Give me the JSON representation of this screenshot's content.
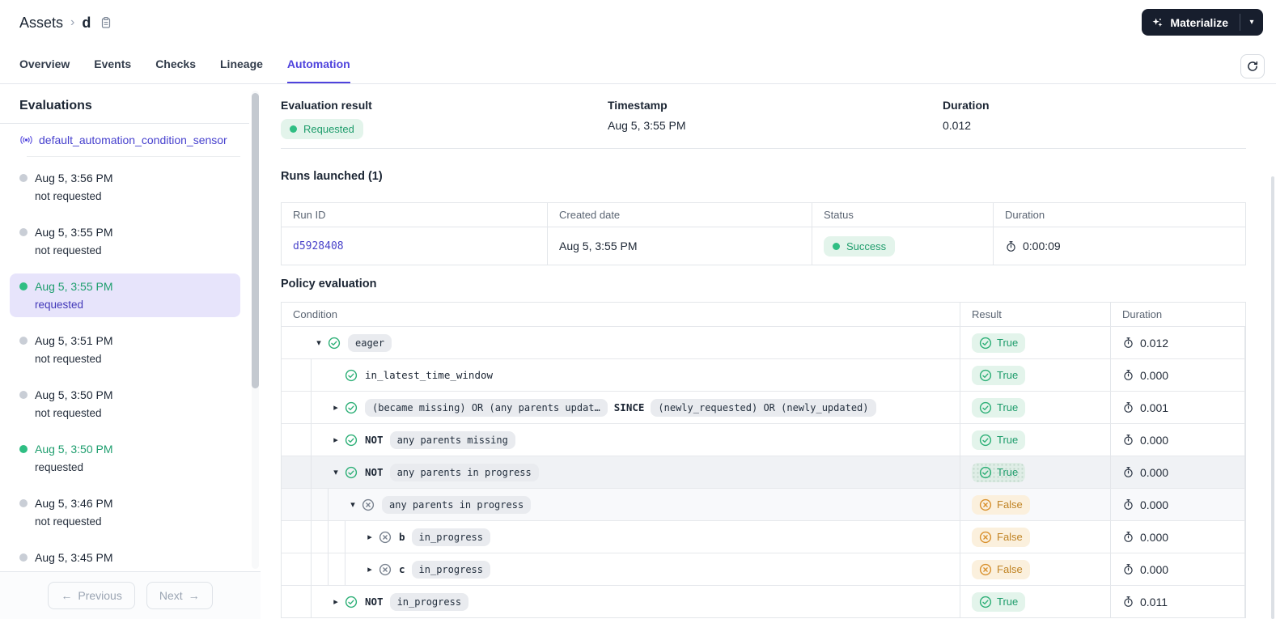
{
  "header": {
    "breadcrumb": {
      "root": "Assets",
      "separator": "›",
      "current": "d"
    },
    "materialize_button": {
      "label": "Materialize"
    }
  },
  "tabs": [
    {
      "label": "Overview",
      "active": false
    },
    {
      "label": "Events",
      "active": false
    },
    {
      "label": "Checks",
      "active": false
    },
    {
      "label": "Lineage",
      "active": false
    },
    {
      "label": "Automation",
      "active": true
    }
  ],
  "sidebar": {
    "title": "Evaluations",
    "sensor_link": "default_automation_condition_sensor",
    "evaluations": [
      {
        "timestamp": "Aug 5, 3:56 PM",
        "status": "not requested",
        "requested": false,
        "selected": false
      },
      {
        "timestamp": "Aug 5, 3:55 PM",
        "status": "not requested",
        "requested": false,
        "selected": false
      },
      {
        "timestamp": "Aug 5, 3:55 PM",
        "status": "requested",
        "requested": true,
        "selected": true
      },
      {
        "timestamp": "Aug 5, 3:51 PM",
        "status": "not requested",
        "requested": false,
        "selected": false
      },
      {
        "timestamp": "Aug 5, 3:50 PM",
        "status": "not requested",
        "requested": false,
        "selected": false
      },
      {
        "timestamp": "Aug 5, 3:50 PM",
        "status": "requested",
        "requested": true,
        "selected": false
      },
      {
        "timestamp": "Aug 5, 3:46 PM",
        "status": "not requested",
        "requested": false,
        "selected": false
      },
      {
        "timestamp": "Aug 5, 3:45 PM",
        "status": "",
        "requested": false,
        "selected": false
      }
    ],
    "pagination": {
      "previous_label": "Previous",
      "next_label": "Next",
      "prev_arrow": "←",
      "next_arrow": "→"
    }
  },
  "summary": {
    "result_label": "Evaluation result",
    "result_value": "Requested",
    "timestamp_label": "Timestamp",
    "timestamp_value": "Aug 5, 3:55 PM",
    "duration_label": "Duration",
    "duration_value": "0.012"
  },
  "runs": {
    "heading": "Runs launched (1)",
    "columns": [
      "Run ID",
      "Created date",
      "Status",
      "Duration"
    ],
    "rows": [
      {
        "run_id": "d5928408",
        "created": "Aug 5, 3:55 PM",
        "status": "Success",
        "duration": "0:00:09"
      }
    ]
  },
  "policy": {
    "heading": "Policy evaluation",
    "columns": [
      "Condition",
      "Result",
      "Duration"
    ],
    "rows": [
      {
        "indent": 0,
        "caret": "down",
        "icon": "check",
        "tokens": [
          {
            "t": "chip",
            "v": "eager"
          }
        ],
        "result": "True",
        "duration": "0.012",
        "highlight": ""
      },
      {
        "indent": 1,
        "caret": "none",
        "icon": "check",
        "tokens": [
          {
            "t": "text",
            "v": "in_latest_time_window"
          }
        ],
        "result": "True",
        "duration": "0.000",
        "highlight": ""
      },
      {
        "indent": 1,
        "caret": "right",
        "icon": "check",
        "tokens": [
          {
            "t": "chip",
            "v": "(became missing) OR (any parents updat…"
          },
          {
            "t": "op",
            "v": "SINCE"
          },
          {
            "t": "chip",
            "v": "(newly_requested) OR (newly_updated)"
          }
        ],
        "result": "True",
        "duration": "0.001",
        "highlight": ""
      },
      {
        "indent": 1,
        "caret": "right",
        "icon": "check",
        "tokens": [
          {
            "t": "op",
            "v": "NOT"
          },
          {
            "t": "chip",
            "v": "any parents missing"
          }
        ],
        "result": "True",
        "duration": "0.000",
        "highlight": ""
      },
      {
        "indent": 1,
        "caret": "down",
        "icon": "check",
        "tokens": [
          {
            "t": "op",
            "v": "NOT"
          },
          {
            "t": "chip",
            "v": "any parents in progress"
          }
        ],
        "result": "True",
        "duration": "0.000",
        "highlight": "strong",
        "result_selected": true
      },
      {
        "indent": 2,
        "caret": "down",
        "icon": "x",
        "tokens": [
          {
            "t": "chip",
            "v": "any parents in progress"
          }
        ],
        "result": "False",
        "duration": "0.000",
        "highlight": "soft"
      },
      {
        "indent": 3,
        "caret": "right",
        "icon": "x",
        "tokens": [
          {
            "t": "op",
            "v": "b"
          },
          {
            "t": "chip",
            "v": "in_progress"
          }
        ],
        "result": "False",
        "duration": "0.000",
        "highlight": ""
      },
      {
        "indent": 3,
        "caret": "right",
        "icon": "x",
        "tokens": [
          {
            "t": "op",
            "v": "c"
          },
          {
            "t": "chip",
            "v": "in_progress"
          }
        ],
        "result": "False",
        "duration": "0.000",
        "highlight": ""
      },
      {
        "indent": 1,
        "caret": "right",
        "icon": "check",
        "tokens": [
          {
            "t": "op",
            "v": "NOT"
          },
          {
            "t": "chip",
            "v": "in_progress"
          }
        ],
        "result": "True",
        "duration": "0.011",
        "highlight": ""
      }
    ]
  },
  "colors": {
    "accent_purple": "#4F43DD",
    "link_purple": "#4741CE",
    "success_green": "#2FBE83",
    "success_text": "#1F9D6C",
    "success_bg": "#E3F4EB",
    "warn_orange": "#C08425",
    "warn_bg": "#FBF0DD",
    "selected_item_bg": "#E7E4FB",
    "dark_button_bg": "#171E2D",
    "chip_bg": "#E9EBEF",
    "border": "#E4E7EC"
  }
}
